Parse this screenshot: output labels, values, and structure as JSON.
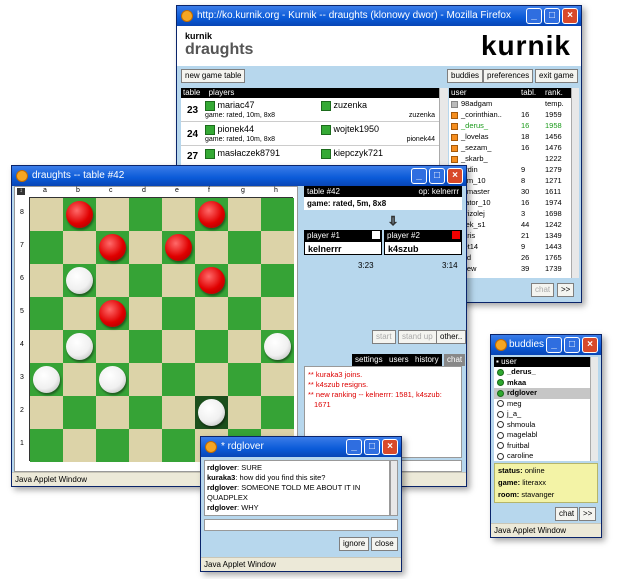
{
  "firefox": {
    "title": "http://ko.kurnik.org - Kurnik -- draughts (klonowy dwor) - Mozilla Firefox",
    "brand_small": "kurnik",
    "brand_heading": "draughts",
    "logo": "kurnik",
    "new_table_btn": "new game table",
    "buddies_btn": "buddies",
    "preferences_btn": "preferences",
    "exit_btn": "exit game",
    "tables_headers": [
      "table",
      "players"
    ],
    "tables": [
      {
        "num": "23",
        "p1": "mariac47",
        "p2": "zuzenka",
        "info": "game: rated, 10m, 8x8",
        "extra": "zuzenka"
      },
      {
        "num": "24",
        "p1": "pionek44",
        "p2": "wojtek1950",
        "info": "game: rated, 10m, 8x8",
        "extra": "pionek44"
      },
      {
        "num": "27",
        "p1": "masłaczek8791",
        "p2": "kiepczyk721",
        "info": "",
        "extra": ""
      }
    ],
    "users_headers": [
      "user",
      "tabl.",
      "rank."
    ],
    "users": [
      {
        "name": "98adgam",
        "tabl": "",
        "rank": "temp.",
        "green": false
      },
      {
        "name": "_corinthian..",
        "tabl": "16",
        "rank": "1959",
        "green": false
      },
      {
        "name": "_derus_",
        "tabl": "16",
        "rank": "1958",
        "green": true
      },
      {
        "name": "_lovelas",
        "tabl": "18",
        "rank": "1456",
        "green": false
      },
      {
        "name": "_sezam_",
        "tabl": "16",
        "rank": "1476",
        "green": false
      },
      {
        "name": "_skarb_",
        "tabl": "",
        "rank": "1222",
        "green": false
      },
      {
        "name": "erdin",
        "tabl": "9",
        "rank": "1279",
        "green": false
      },
      {
        "name": "him_10",
        "tabl": "8",
        "rank": "1271",
        "green": false
      },
      {
        "name": "i_master",
        "tabl": "30",
        "rank": "1611",
        "green": false
      },
      {
        "name": "nator_10",
        "tabl": "16",
        "rank": "1974",
        "green": false
      },
      {
        "name": "drizolej",
        "tabl": "3",
        "rank": "1698",
        "green": false
      },
      {
        "name": "rtek_s1",
        "tabl": "44",
        "rank": "1242",
        "green": false
      },
      {
        "name": "atris",
        "tabl": "21",
        "rank": "1349",
        "green": false
      },
      {
        "name": "ret14",
        "tabl": "9",
        "rank": "1443",
        "green": false
      },
      {
        "name": "jad",
        "tabl": "26",
        "rank": "1765",
        "green": false
      },
      {
        "name": "hiew",
        "tabl": "39",
        "rank": "1739",
        "green": false
      }
    ],
    "chat_btn": "chat",
    "more_btn": ">>"
  },
  "draughts": {
    "title": "draughts -- table #42",
    "files": [
      "a",
      "b",
      "c",
      "d",
      "e",
      "f",
      "g",
      "h"
    ],
    "ranks": [
      "8",
      "7",
      "6",
      "5",
      "4",
      "3",
      "2",
      "1"
    ],
    "table_label": "table #42",
    "op_label": "op: kelnerrr",
    "game_info": "game: rated, 5m, 8x8",
    "player1_label": "player #1",
    "player2_label": "player #2",
    "player1_name": "kelnerrr",
    "player2_name": "k4szub",
    "time1": "3:23",
    "time2": "3:14",
    "start_btn": "start",
    "standup_btn": "stand up",
    "other_btn": "other..",
    "tabs": [
      "settings",
      "users",
      "history",
      "chat"
    ],
    "chat_lines": [
      "** kuraka3 joins.",
      "** k4szub resigns.",
      "** new ranking -- kelnerrr: 1581, k4szub: 1671"
    ],
    "status": "Java Applet Window",
    "pieces": [
      {
        "sq": "b8",
        "c": "red"
      },
      {
        "sq": "f8",
        "c": "red"
      },
      {
        "sq": "c7",
        "c": "red"
      },
      {
        "sq": "e7",
        "c": "red"
      },
      {
        "sq": "b6",
        "c": "white"
      },
      {
        "sq": "f6",
        "c": "red"
      },
      {
        "sq": "c5",
        "c": "red"
      },
      {
        "sq": "b4",
        "c": "white"
      },
      {
        "sq": "h4",
        "c": "white"
      },
      {
        "sq": "a3",
        "c": "white"
      },
      {
        "sq": "c3",
        "c": "white"
      },
      {
        "sq": "f2",
        "c": "white"
      }
    ],
    "highlight": "f2"
  },
  "rdglover": {
    "title": "* rdglover",
    "lines": [
      {
        "who": "rdglover",
        "text": "SURE"
      },
      {
        "who": "kuraka3",
        "text": "how did you find this site?"
      },
      {
        "who": "rdglover",
        "text": "SOMEONE TOLD ME ABOUT IT IN QUADPLEX"
      },
      {
        "who": "rdglover",
        "text": "WHY"
      }
    ],
    "ignore_btn": "ignore",
    "close_btn": "close",
    "status": "Java Applet Window"
  },
  "buddies": {
    "title": "buddies (3)",
    "header": "user",
    "list": [
      {
        "name": "_derus_",
        "online": true
      },
      {
        "name": "mkaa",
        "online": true
      },
      {
        "name": "rdglover",
        "online": true,
        "selected": true
      },
      {
        "name": "meg",
        "online": false
      },
      {
        "name": "j_a_",
        "online": false
      },
      {
        "name": "shmoula",
        "online": false
      },
      {
        "name": "magelabl",
        "online": false
      },
      {
        "name": "fruitbal",
        "online": false
      },
      {
        "name": "caroline",
        "online": false
      }
    ],
    "status_label": "status:",
    "status_value": "online",
    "game_label": "game:",
    "game_value": "literaxx",
    "room_label": "room:",
    "room_value": "stavanger",
    "chat_btn": "chat",
    "more_btn": ">>",
    "statusbar": "Java Applet Window"
  }
}
